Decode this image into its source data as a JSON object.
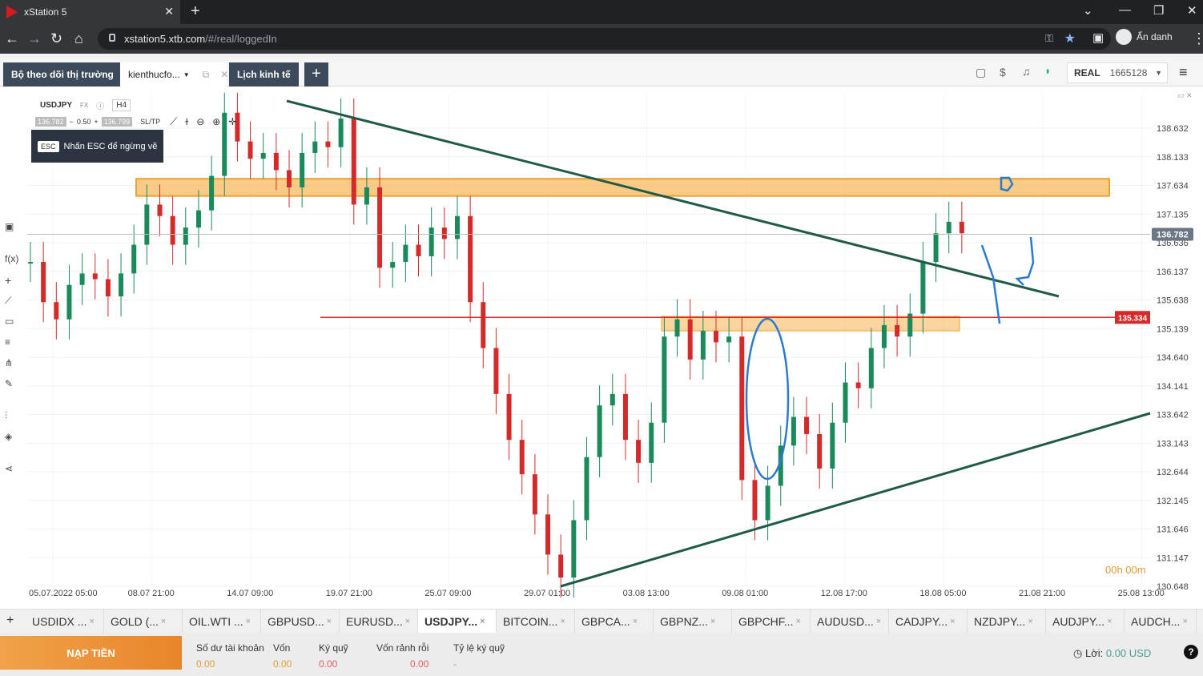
{
  "browser": {
    "tab_title": "xStation 5",
    "tab_close": "✕",
    "new_tab": "+",
    "url_host": "xstation5.xtb.com",
    "url_path": "/#/real/loggedIn",
    "profile_label": "Ẩn danh",
    "window_min": "—",
    "window_max": "❐",
    "window_close": "✕"
  },
  "app": {
    "tabs": [
      "Bộ theo dõi thị trường",
      "kienthucfo...",
      "Lịch kinh tế"
    ],
    "add_tab": "+",
    "account_type": "REAL",
    "account_number": "1665128"
  },
  "chart_header": {
    "symbol": "USDJPY",
    "asset_class": "FX",
    "timeframe": "H4",
    "bid": "136.782",
    "volume": "0.50",
    "ask": "136.799",
    "sltp": "SL/TP",
    "esc_key": "ESC",
    "esc_hint": "Nhấn ESC để ngừng vẽ",
    "countdown": "00h 00m"
  },
  "chart_data": {
    "type": "line",
    "symbol": "USDJPY",
    "timeframe": "H4",
    "y_ticks": [
      "138.632",
      "138.133",
      "137.634",
      "137.135",
      "136.636",
      "136.137",
      "135.638",
      "135.139",
      "134.640",
      "134.141",
      "133.642",
      "133.143",
      "132.644",
      "132.145",
      "131.646",
      "131.147",
      "130.648"
    ],
    "x_ticks": [
      "05.07.2022 05:00",
      "08.07 21:00",
      "14.07 09:00",
      "19.07 21:00",
      "25.07 09:00",
      "29.07 01:00",
      "03.08 13:00",
      "09.08 01:00",
      "12.08 17:00",
      "18.08 05:00",
      "21.08 21:00",
      "25.08 13:00"
    ],
    "ylim": [
      130.648,
      138.632
    ],
    "current_price": 136.782,
    "current_price_label": "136.782",
    "horizontal_line": 135.334,
    "horizontal_line_label": "135.334",
    "series": [
      {
        "values": [
          136.3,
          135.6,
          135.3,
          135.9,
          136.1,
          136.0,
          135.7,
          136.1,
          136.6,
          137.3,
          137.1,
          136.6,
          136.9,
          137.2,
          137.8,
          138.9,
          138.4,
          138.1,
          138.2,
          137.9,
          137.6,
          138.2,
          138.4,
          138.3,
          138.8,
          137.3,
          137.6,
          136.2,
          136.3,
          136.6,
          136.4,
          136.9,
          136.7,
          137.1,
          135.6,
          134.8,
          134.0,
          133.2,
          132.6,
          131.9,
          131.2,
          130.8,
          131.8,
          132.9,
          133.8,
          134.0,
          133.2,
          132.8,
          133.5,
          135.0,
          135.3,
          134.6,
          135.1,
          134.9,
          135.0,
          132.5,
          131.8,
          132.4,
          133.1,
          133.6,
          133.3,
          132.7,
          133.5,
          134.2,
          134.1,
          134.8,
          135.2,
          135.0,
          135.4,
          136.3,
          136.8,
          137.0,
          136.8
        ]
      }
    ],
    "annotations": {
      "upper_zone": [
        137.45,
        137.75
      ],
      "lower_zone": [
        135.1,
        135.35
      ],
      "descending_trendline": [
        [
          0.0,
          138.9
        ],
        [
          1.0,
          135.6
        ]
      ],
      "ascending_trendline": [
        [
          0.0,
          130.6
        ],
        [
          1.0,
          133.7
        ]
      ]
    }
  },
  "instruments": [
    "USDIDX ...",
    "GOLD (...",
    "OIL.WTI ...",
    "GBPUSD...",
    "EURUSD...",
    "USDJPY...",
    "BITCOIN...",
    "GBPCA...",
    "GBPNZ...",
    "GBPCHF...",
    "AUDUSD...",
    "CADJPY...",
    "NZDJPY...",
    "AUDJPY...",
    "AUDCH..."
  ],
  "instrument_close": "×",
  "instrument_add": "+",
  "account": {
    "deposit_label": "NẠP TIỀN",
    "balance_label": "Số dư tài khoản",
    "balance": "0.00",
    "equity_label": "Vốn",
    "equity": "0.00",
    "margin_label": "Ký quỹ",
    "margin": "0.00",
    "free_margin_label": "Vốn rảnh rỗi",
    "free_margin": "0.00",
    "margin_level_label": "Tỷ lệ ký quỹ",
    "margin_level": "-",
    "profit_label": "Lời:",
    "profit_value": "0.00 USD",
    "help": "?"
  },
  "colors": {
    "bull": "#1a8a5a",
    "bear": "#d42a2a",
    "trendline": "#1f5a48",
    "zone": "#f7b95e",
    "hline": "#d42a2a",
    "pen": "#2a7ad4"
  }
}
